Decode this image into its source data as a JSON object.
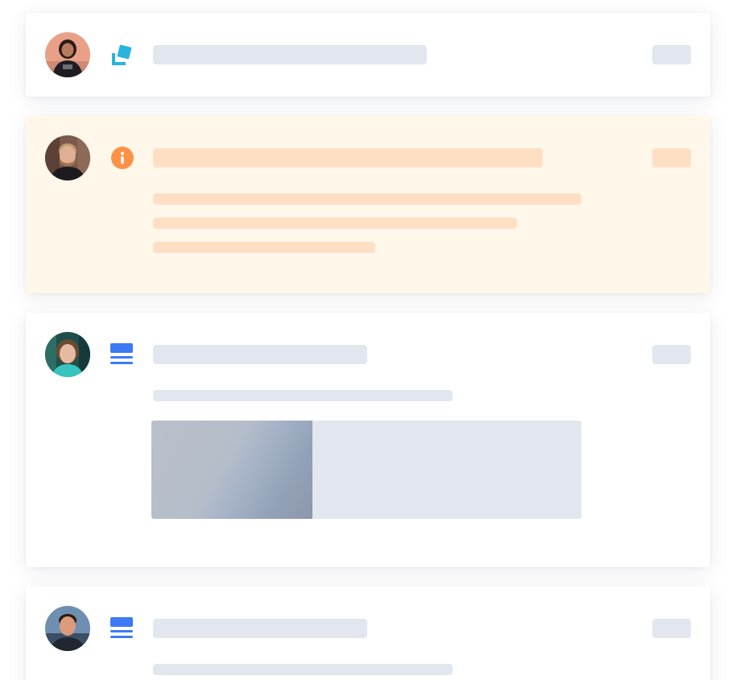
{
  "colors": {
    "page_background": "#ffffff",
    "card_background": "#ffffff",
    "highlight_background": "#fff7ea",
    "placeholder_bar": "#e2e6ef",
    "placeholder_bar_warm": "#ffdfc3",
    "teal_icon": "#28b4dc",
    "orange_icon": "#ff9148",
    "blue_icon": "#3d7bf5"
  },
  "feed": {
    "items": [
      {
        "avatar": "woman-dark-hair-avatar",
        "type_icon": "stacked-cards-icon",
        "state": "default",
        "content": "skeleton-title"
      },
      {
        "avatar": "man-beard-avatar",
        "type_icon": "info-icon",
        "state": "highlighted",
        "content": "skeleton-title-and-three-lines"
      },
      {
        "avatar": "woman-smiling-avatar",
        "type_icon": "list-icon",
        "state": "default",
        "content": "skeleton-title-line-and-attachment"
      },
      {
        "avatar": "man-outdoor-avatar",
        "type_icon": "list-icon",
        "state": "default",
        "content": "skeleton-title-and-line"
      }
    ]
  }
}
